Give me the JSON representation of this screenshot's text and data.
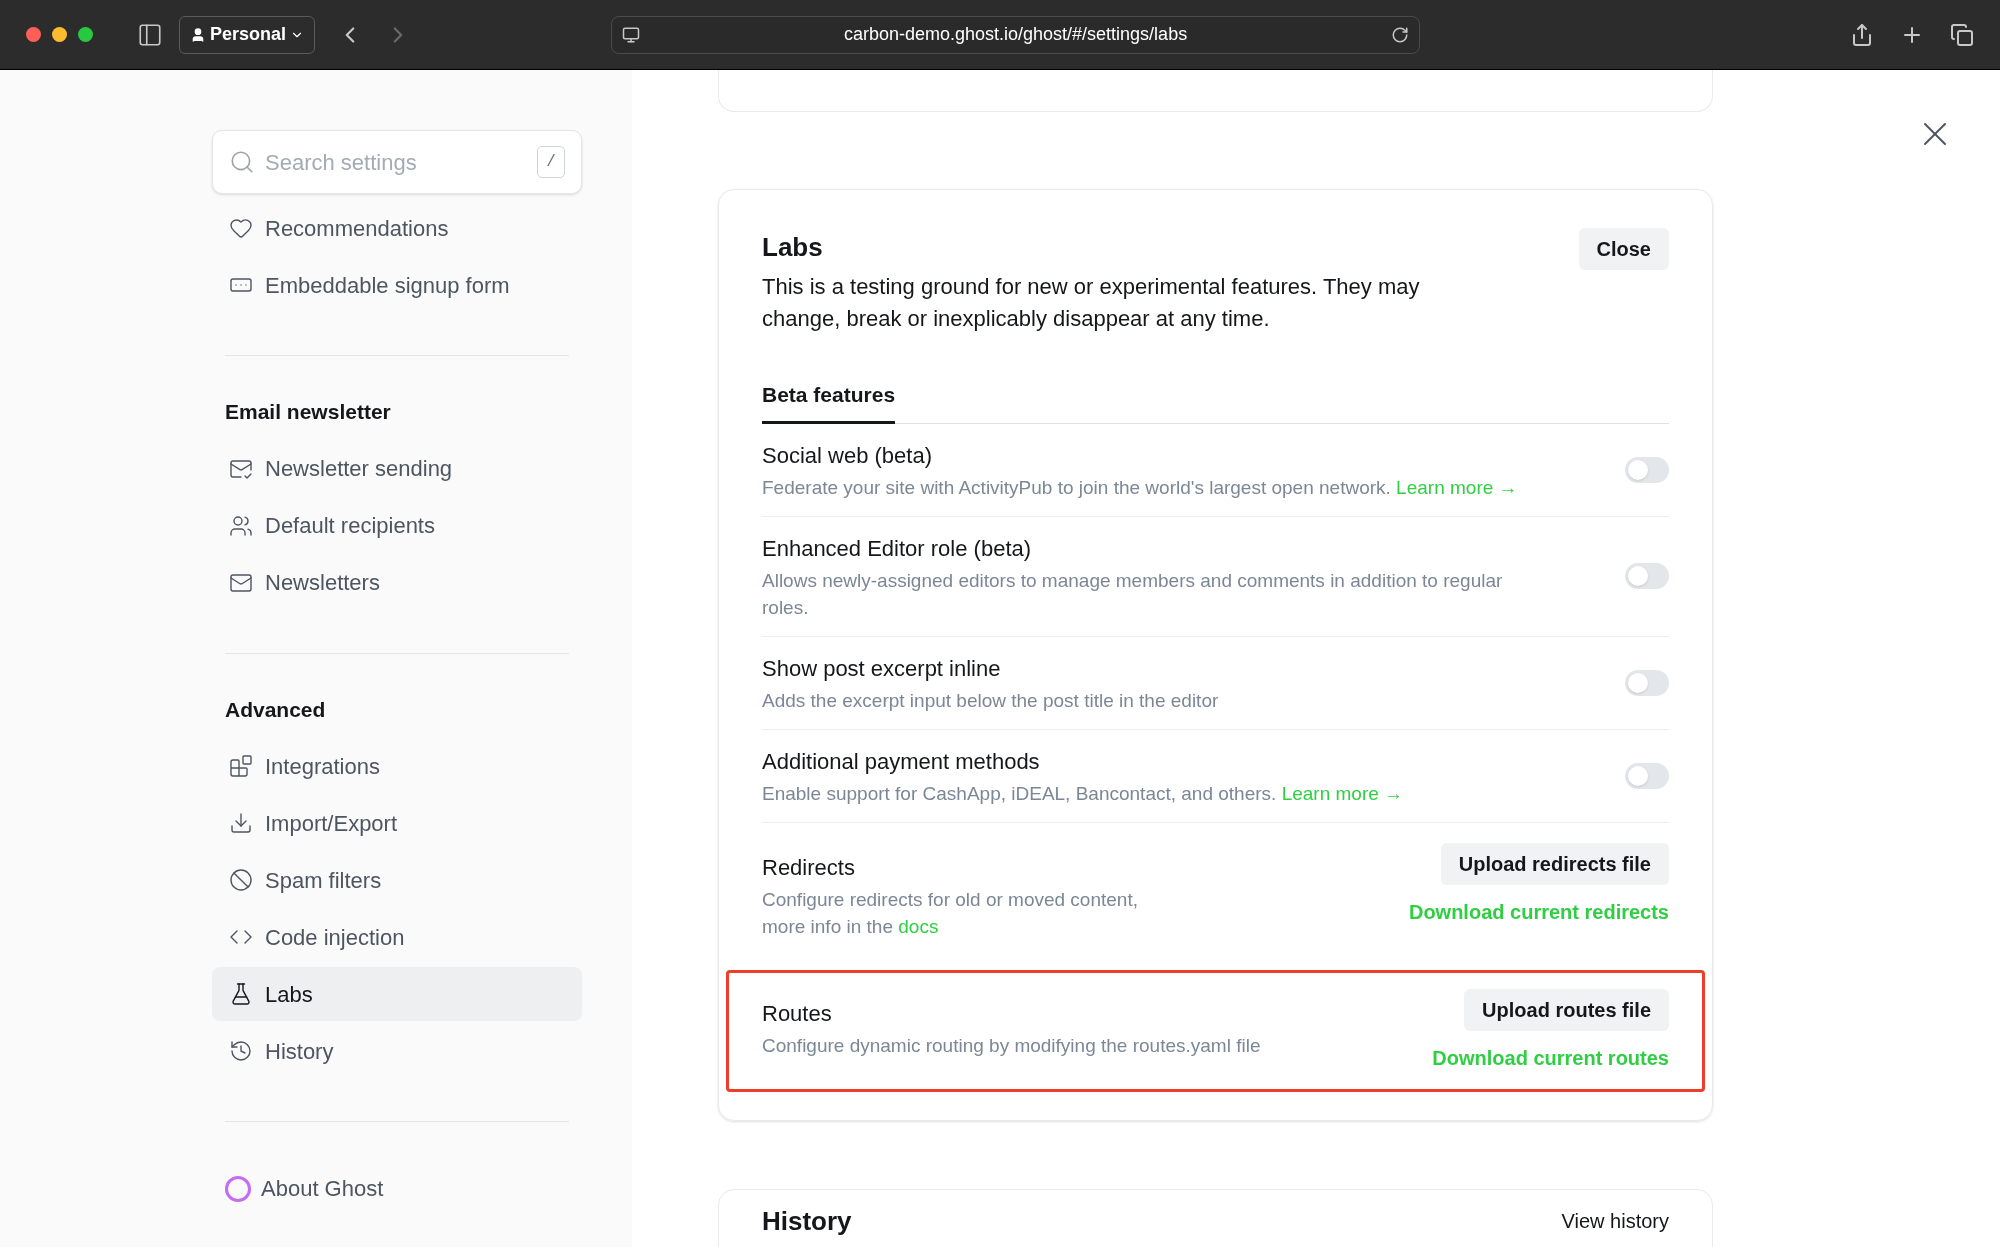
{
  "browser": {
    "profile": "Personal",
    "url": "carbon-demo.ghost.io/ghost/#/settings/labs"
  },
  "sidebar": {
    "search": {
      "placeholder": "Search settings",
      "shortcut": "/"
    },
    "groups": [
      {
        "items": [
          {
            "label": "Recommendations",
            "selected": false
          },
          {
            "label": "Embeddable signup form",
            "selected": false
          }
        ]
      },
      {
        "title": "Email newsletter",
        "items": [
          {
            "label": "Newsletter sending",
            "selected": false
          },
          {
            "label": "Default recipients",
            "selected": false
          },
          {
            "label": "Newsletters",
            "selected": false
          }
        ]
      },
      {
        "title": "Advanced",
        "items": [
          {
            "label": "Integrations",
            "selected": false
          },
          {
            "label": "Import/Export",
            "selected": false
          },
          {
            "label": "Spam filters",
            "selected": false
          },
          {
            "label": "Code injection",
            "selected": false
          },
          {
            "label": "Labs",
            "selected": true
          },
          {
            "label": "History",
            "selected": false
          }
        ]
      }
    ],
    "about": "About Ghost"
  },
  "labs": {
    "title": "Labs",
    "close": "Close",
    "description": "This is a testing ground for new or experimental features. They may change, break or inexplicably disappear at any time.",
    "tabs": [
      {
        "label": "Beta features",
        "selected": true
      }
    ],
    "features": [
      {
        "kind": "toggle",
        "title": "Social web (beta)",
        "description": "Federate your site with ActivityPub to join the world's largest open network.",
        "link": "Learn more →",
        "on": false
      },
      {
        "kind": "toggle",
        "title": "Enhanced Editor role (beta)",
        "description": "Allows newly-assigned editors to manage members and comments in addition to regular roles.",
        "on": false
      },
      {
        "kind": "toggle",
        "title": "Show post excerpt inline",
        "description": "Adds the excerpt input below the post title in the editor",
        "on": false
      },
      {
        "kind": "toggle",
        "title": "Additional payment methods",
        "description": "Enable support for CashApp, iDEAL, Bancontact, and others.",
        "link": "Learn more →",
        "on": false
      },
      {
        "kind": "files",
        "title": "Redirects",
        "description": "Configure redirects for old or moved content,",
        "description_2": "more info in the",
        "link": "docs",
        "upload": "Upload redirects file",
        "download": "Download current redirects",
        "highlighted": false
      },
      {
        "kind": "files",
        "title": "Routes",
        "description": "Configure dynamic routing by modifying the routes.yaml file",
        "upload": "Upload routes file",
        "download": "Download current routes",
        "highlighted": true
      }
    ]
  },
  "history": {
    "title": "History",
    "action": "View history"
  }
}
